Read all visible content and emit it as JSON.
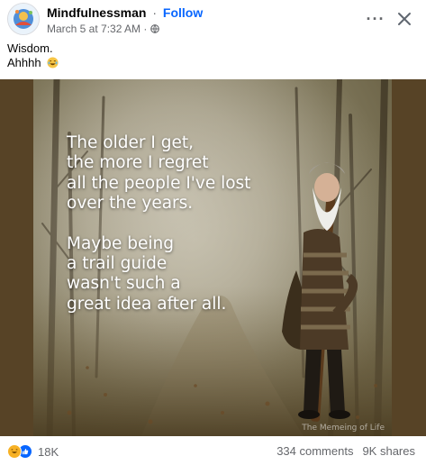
{
  "post": {
    "author": "Mindfulnessman",
    "separator": "·",
    "follow_label": "Follow",
    "timestamp": "March 5 at 7:32 AM ·",
    "privacy_icon": "globe-icon",
    "more_label": "···",
    "close_icon": "close-icon",
    "caption_lines": [
      "Wisdom.",
      "Ahhhh"
    ],
    "caption_emoji": "laughing-emoji"
  },
  "image": {
    "quote_part1": [
      "The older I get,",
      "the more I regret",
      "all the people I've lost",
      "over the years."
    ],
    "quote_part2": [
      "Maybe being",
      "a trail guide",
      "wasn't such a",
      "great idea after all."
    ],
    "watermark": "The Memeing of Life"
  },
  "footer": {
    "reaction_icons": [
      "haha-icon",
      "like-icon"
    ],
    "reaction_count": "18K",
    "comments": "334 comments",
    "shares": "9K shares"
  },
  "colors": {
    "follow": "#0866ff",
    "secondary_text": "#65676b",
    "image_border": "#574326"
  }
}
